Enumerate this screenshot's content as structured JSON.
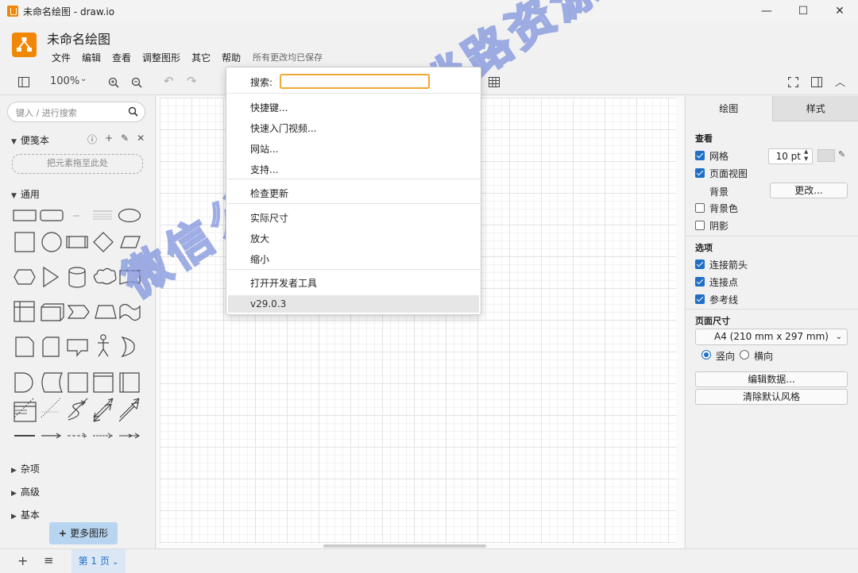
{
  "window": {
    "title": "未命名绘图 - draw.io",
    "minimize": "—",
    "maximize": "☐",
    "close": "✕"
  },
  "app": {
    "doc_title": "未命名绘图",
    "saved_status": "所有更改均已保存"
  },
  "menu": [
    "文件",
    "编辑",
    "查看",
    "调整图形",
    "其它",
    "帮助"
  ],
  "toolbar": {
    "zoom": "100%"
  },
  "sidebar": {
    "search_placeholder": "键入 / 进行搜索",
    "scratchpad": "便笺本",
    "dropzone": "把元素拖至此处",
    "general": "通用",
    "sections": [
      "杂项",
      "高级",
      "基本"
    ],
    "more_shapes": "更多图形"
  },
  "help_menu": {
    "search_label": "搜索:",
    "items": [
      "快捷键...",
      "快速入门视频...",
      "网站...",
      "支持..."
    ],
    "check_updates": "检查更新",
    "view_items": [
      "实际尺寸",
      "放大",
      "缩小"
    ],
    "dev_tools": "打开开发者工具",
    "version": "v29.0.3"
  },
  "right_panel": {
    "tabs": [
      "绘图",
      "样式"
    ],
    "view_title": "查看",
    "grid": "网格",
    "grid_size": "10 pt",
    "page_view": "页面视图",
    "background": "背景",
    "change": "更改...",
    "bg_color": "背景色",
    "shadow": "阴影",
    "options_title": "选项",
    "connection_arrows": "连接箭头",
    "connection_points": "连接点",
    "guides": "参考线",
    "page_size_title": "页面尺寸",
    "page_size": "A4 (210 mm x 297 mm)",
    "portrait": "竖向",
    "landscape": "横向",
    "edit_data": "编辑数据...",
    "clear_style": "清除默认风格"
  },
  "bottom": {
    "page_tab": "第 1 页"
  },
  "watermark": "微信公众号：不淡路资源库"
}
